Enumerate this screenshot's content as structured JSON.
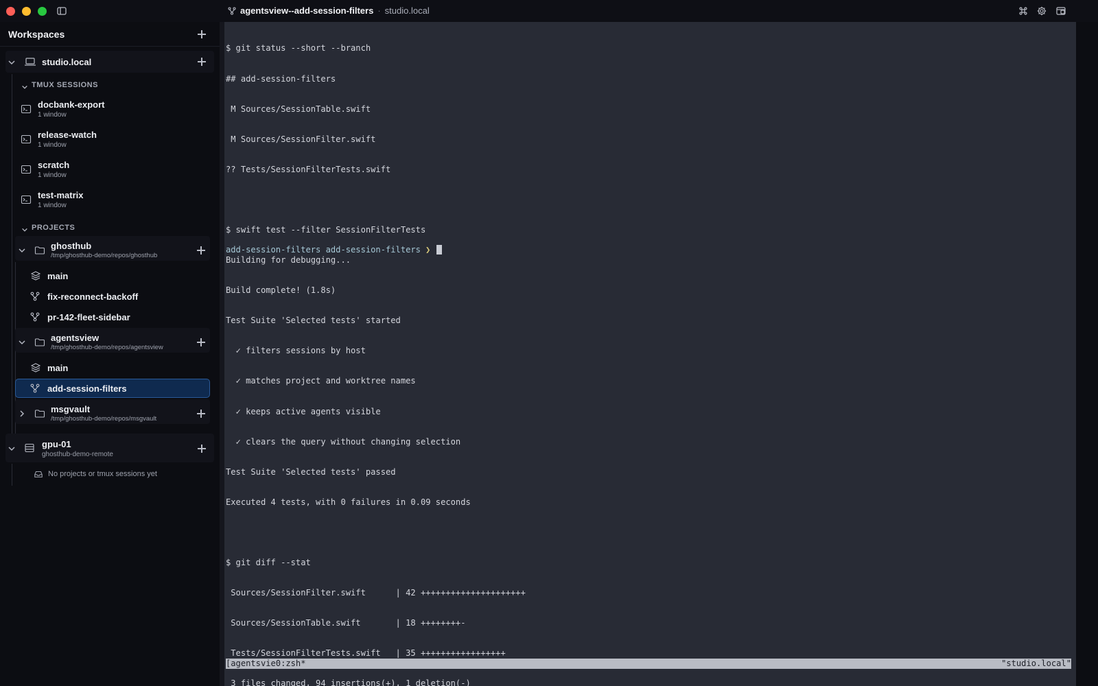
{
  "window": {
    "title": "agentsview--add-session-filters",
    "separator": "·",
    "host": "studio.local"
  },
  "sidebar": {
    "header": "Workspaces",
    "hosts": [
      {
        "name": "studio.local",
        "tmux_label": "TMUX SESSIONS",
        "tmux_sessions": [
          {
            "name": "docbank-export",
            "detail": "1 window"
          },
          {
            "name": "release-watch",
            "detail": "1 window"
          },
          {
            "name": "scratch",
            "detail": "1 window"
          },
          {
            "name": "test-matrix",
            "detail": "1 window"
          }
        ],
        "projects_label": "PROJECTS",
        "projects": [
          {
            "name": "ghosthub",
            "path": "/tmp/ghosthub-demo/repos/ghosthub",
            "branches": [
              {
                "name": "main",
                "icon": "layers-icon"
              },
              {
                "name": "fix-reconnect-backoff",
                "icon": "branch-icon"
              },
              {
                "name": "pr-142-fleet-sidebar",
                "icon": "branch-icon"
              }
            ]
          },
          {
            "name": "agentsview",
            "path": "/tmp/ghosthub-demo/repos/agentsview",
            "branches": [
              {
                "name": "main",
                "icon": "layers-icon"
              },
              {
                "name": "add-session-filters",
                "icon": "branch-icon",
                "selected": true
              }
            ]
          },
          {
            "name": "msgvault",
            "path": "/tmp/ghosthub-demo/repos/msgvault",
            "collapsed": true
          }
        ]
      },
      {
        "name": "gpu-01",
        "detail": "ghosthub-demo-remote",
        "empty_message": "No projects or tmux sessions yet"
      }
    ]
  },
  "terminal": {
    "lines": [
      "$ git status --short --branch",
      "## add-session-filters",
      " M Sources/SessionTable.swift",
      " M Sources/SessionFilter.swift",
      "?? Tests/SessionFilterTests.swift",
      "",
      "$ swift test --filter SessionFilterTests",
      "Building for debugging...",
      "Build complete! (1.8s)",
      "Test Suite 'Selected tests' started",
      "  ✓ filters sessions by host",
      "  ✓ matches project and worktree names",
      "  ✓ keeps active agents visible",
      "  ✓ clears the query without changing selection",
      "Test Suite 'Selected tests' passed",
      "Executed 4 tests, with 0 failures in 0.09 seconds",
      "",
      "$ git diff --stat",
      " Sources/SessionFilter.swift      | 42 +++++++++++++++++++++",
      " Sources/SessionTable.swift       | 18 ++++++++-",
      " Tests/SessionFilterTests.swift   | 35 +++++++++++++++++",
      " 3 files changed, 94 insertions(+), 1 deletion(-)"
    ],
    "prompt_branch": "add-session-filters add-session-filters",
    "prompt_symbol": "❯",
    "status_left": "[agentsvie0:zsh*",
    "status_right": "\"studio.local\""
  }
}
